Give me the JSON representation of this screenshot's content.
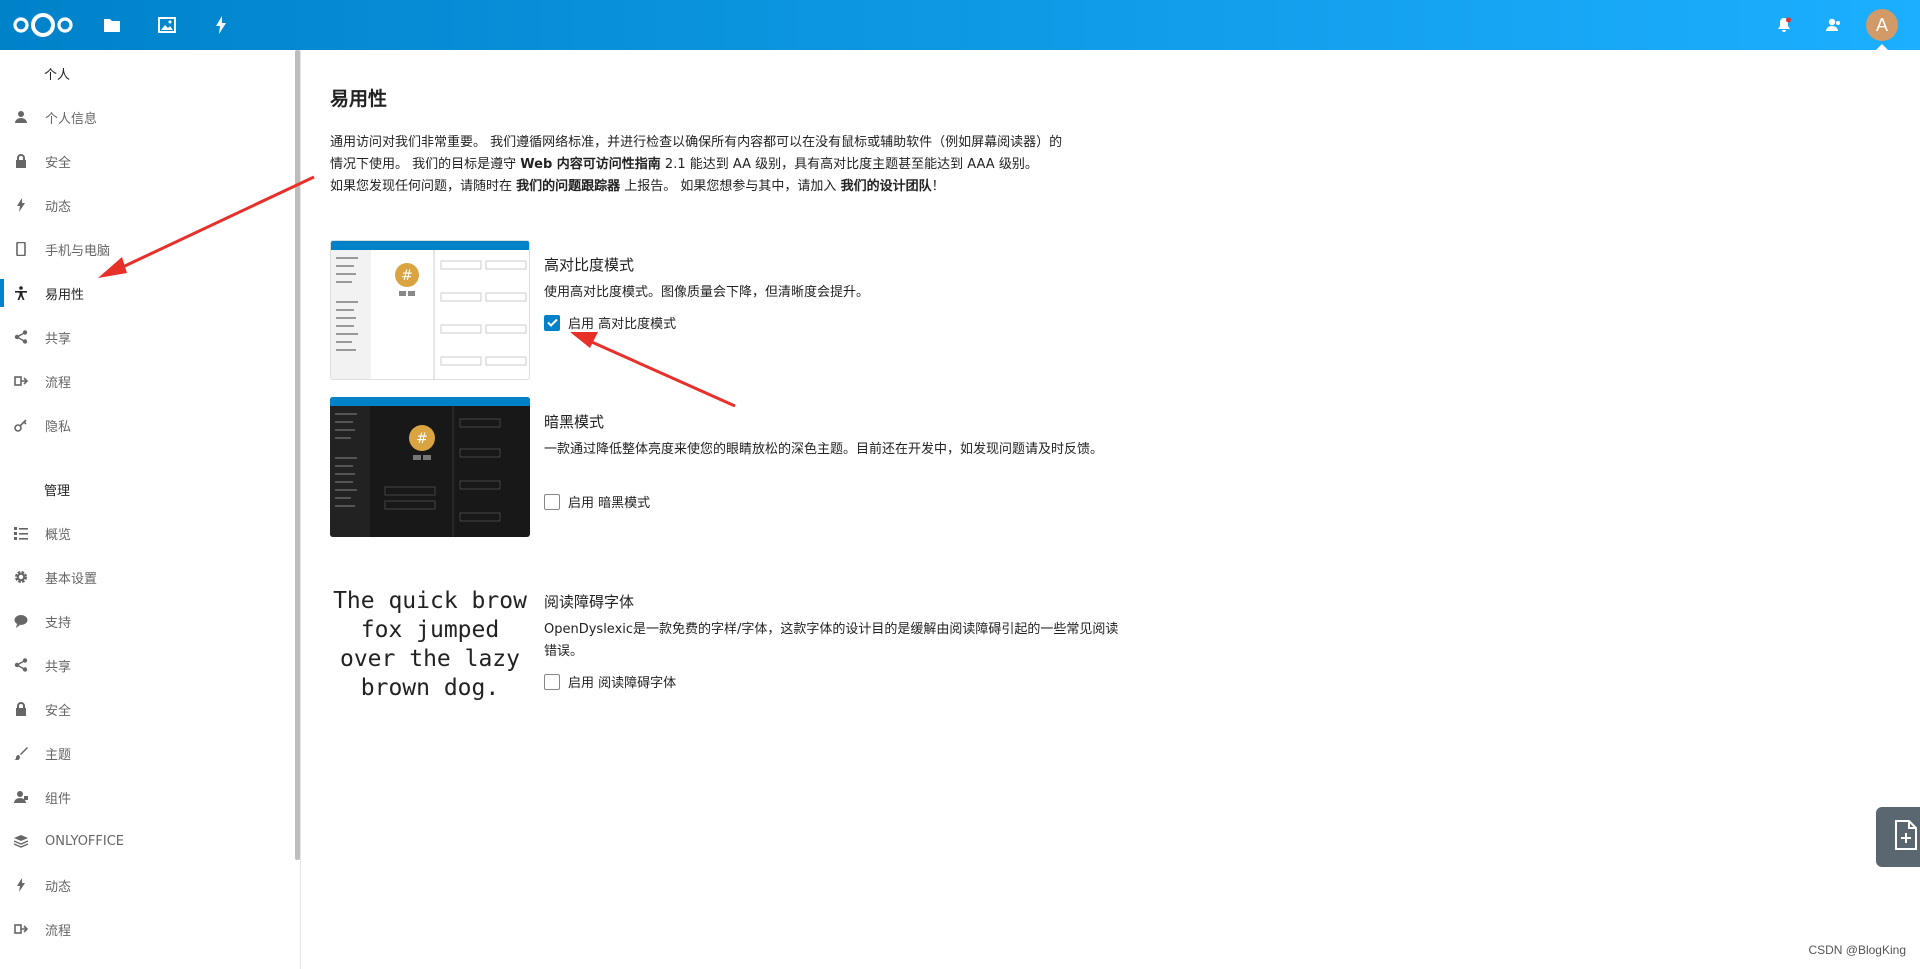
{
  "header": {
    "logo_icon": "nextcloud-logo",
    "apps": [
      {
        "icon": "folder-icon"
      },
      {
        "icon": "image-icon"
      },
      {
        "icon": "lightning-icon"
      }
    ],
    "right_icons": [
      "notification-bell-icon",
      "contacts-icon"
    ],
    "avatar_letter": "A",
    "accent": "#0082c9"
  },
  "sidebar": {
    "personal_heading": "个人",
    "personal_items": [
      {
        "label": "个人信息",
        "icon": "user-icon"
      },
      {
        "label": "安全",
        "icon": "lock-icon"
      },
      {
        "label": "动态",
        "icon": "lightning-icon"
      },
      {
        "label": "手机与电脑",
        "icon": "phone-icon"
      },
      {
        "label": "易用性",
        "icon": "accessibility-icon",
        "active": true
      },
      {
        "label": "共享",
        "icon": "share-icon"
      },
      {
        "label": "流程",
        "icon": "flow-icon"
      },
      {
        "label": "隐私",
        "icon": "key-icon"
      }
    ],
    "admin_heading": "管理",
    "admin_items": [
      {
        "label": "概览",
        "icon": "list-icon"
      },
      {
        "label": "基本设置",
        "icon": "gear-icon"
      },
      {
        "label": "支持",
        "icon": "chat-bubble-icon"
      },
      {
        "label": "共享",
        "icon": "share-icon"
      },
      {
        "label": "安全",
        "icon": "lock-icon"
      },
      {
        "label": "主题",
        "icon": "brush-icon"
      },
      {
        "label": "组件",
        "icon": "puzzle-user-icon"
      },
      {
        "label": "ONLYOFFICE",
        "icon": "layers-icon"
      },
      {
        "label": "动态",
        "icon": "lightning-icon"
      },
      {
        "label": "流程",
        "icon": "flow-icon"
      }
    ]
  },
  "main": {
    "title": "易用性",
    "intro": {
      "p1_a": "通用访问对我们非常重要。 我们遵循网络标准，并进行检查以确保所有内容都可以在没有鼠标或辅助软件（例如屏幕阅读器）的",
      "p1_b": "情况下使用。 我们的目标是遵守 ",
      "link_wcag": "Web 内容可访问性指南",
      "p1_c": " 2.1 能达到 AA 级别，具有高对比度主题甚至能达到 AAA 级别。",
      "p2_a": "如果您发现任何问题，请随时在 ",
      "link_tracker": "我们的问题跟踪器",
      "p2_b": " 上报告。 如果您想参与其中，请加入 ",
      "link_team": "我们的设计团队",
      "p2_c": "！"
    },
    "features": [
      {
        "title": "高对比度模式",
        "desc": "使用高对比度模式。图像质量会下降，但清晰度会提升。",
        "checkbox_label": "启用 高对比度模式",
        "checked": true
      },
      {
        "title": "暗黑模式",
        "desc": "一款通过降低整体亮度来使您的眼睛放松的深色主题。目前还在开发中，如发现问题请及时反馈。",
        "checkbox_label": "启用 暗黑模式",
        "checked": false
      },
      {
        "title": "阅读障碍字体",
        "desc": "OpenDyslexic是一款免费的字样/字体，这款字体的设计目的是缓解由阅读障碍引起的一些常见阅读错误。",
        "checkbox_label": "启用 阅读障碍字体",
        "checked": false,
        "sample_lines": [
          "The quick brow",
          "fox jumped",
          "over the lazy",
          "brown dog."
        ]
      }
    ]
  },
  "floating_button_icon": "add-document-icon",
  "watermark": "CSDN @BlogKing",
  "annotation_color": "#e8302a"
}
